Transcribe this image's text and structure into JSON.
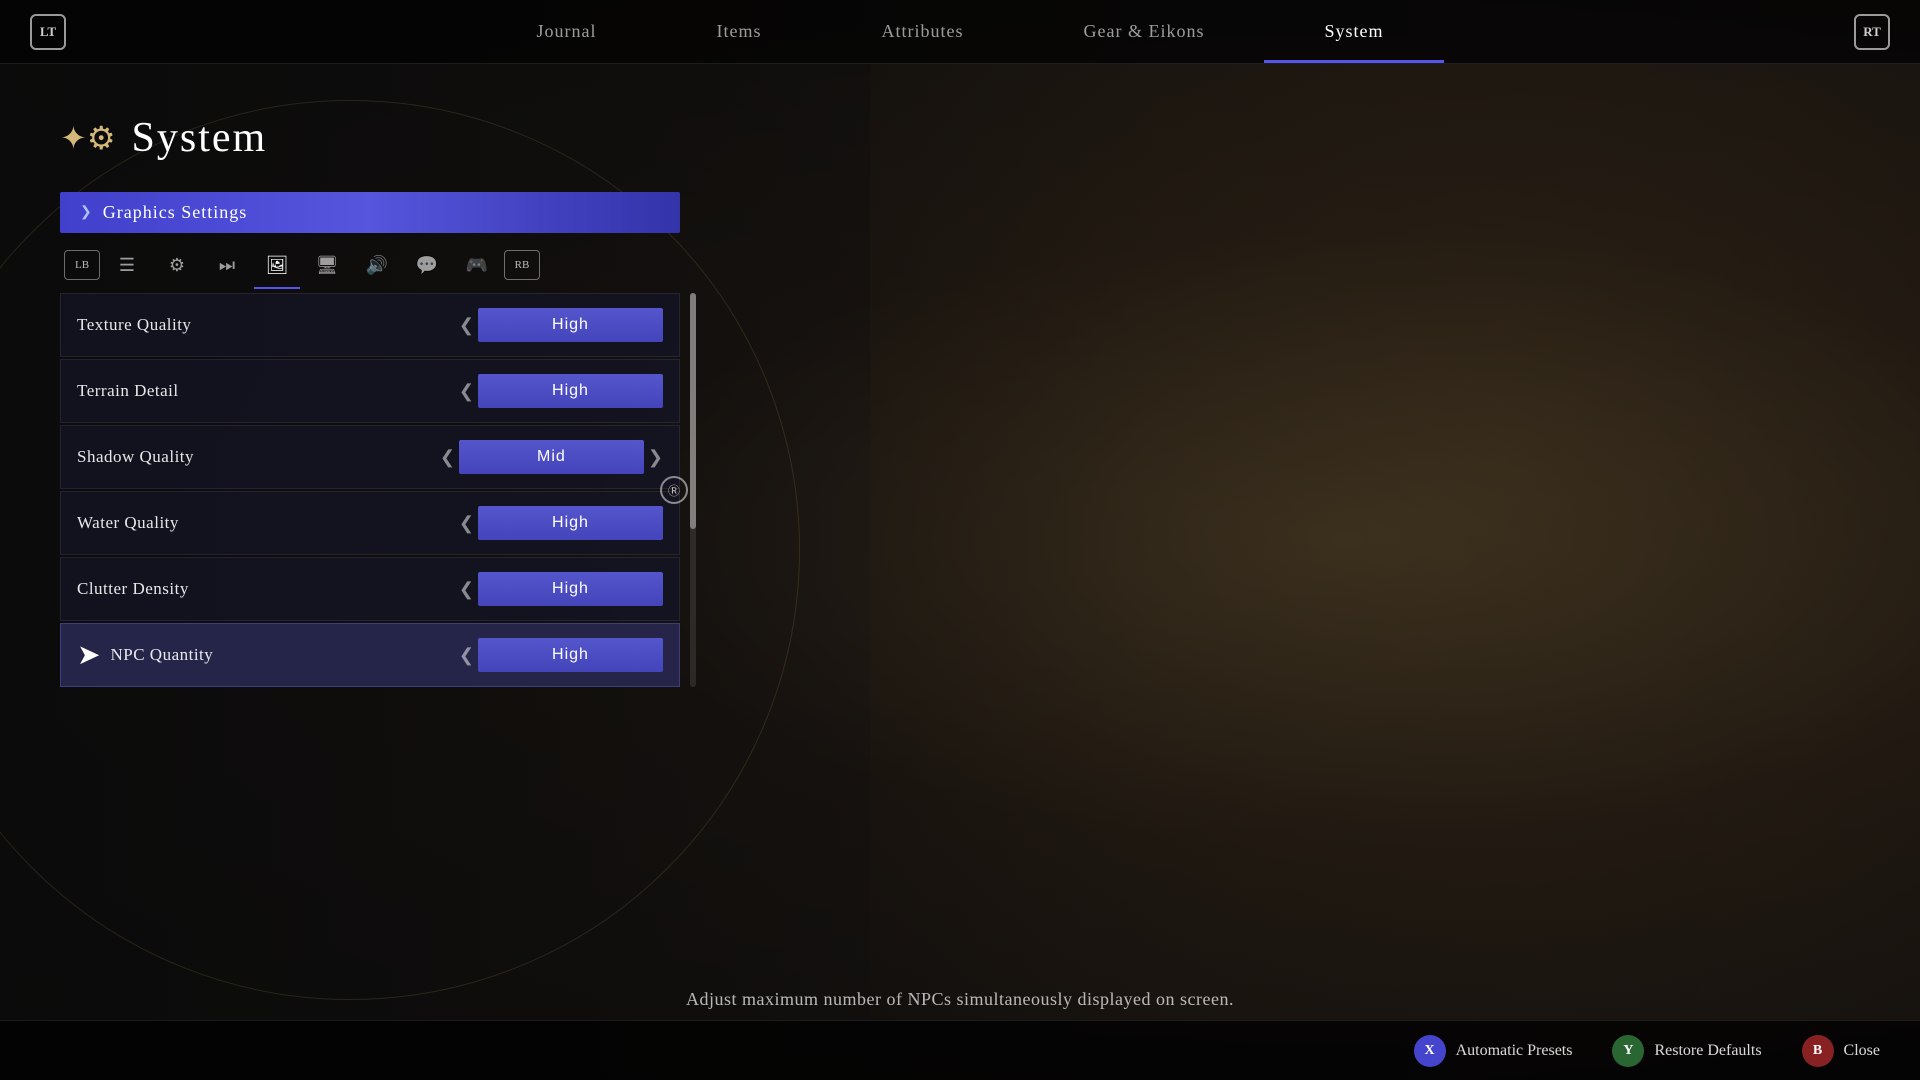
{
  "nav": {
    "left_btn": "LT",
    "right_btn": "RT",
    "tabs": [
      {
        "id": "journal",
        "label": "Journal",
        "active": false
      },
      {
        "id": "items",
        "label": "Items",
        "active": false
      },
      {
        "id": "attributes",
        "label": "Attributes",
        "active": false
      },
      {
        "id": "gear",
        "label": "Gear & Eikons",
        "active": false
      },
      {
        "id": "system",
        "label": "System",
        "active": true
      }
    ]
  },
  "page": {
    "title": "System",
    "icon": "⚙"
  },
  "section": {
    "label": "Graphics Settings"
  },
  "tab_icons": [
    {
      "id": "lb",
      "label": "LB",
      "type": "nav"
    },
    {
      "id": "list",
      "symbol": "☰",
      "active": false
    },
    {
      "id": "gear",
      "symbol": "⚙",
      "active": false
    },
    {
      "id": "media",
      "symbol": "⏭",
      "active": false
    },
    {
      "id": "image",
      "symbol": "🖼",
      "active": true
    },
    {
      "id": "display",
      "symbol": "🖥",
      "active": false
    },
    {
      "id": "audio",
      "symbol": "🔊",
      "active": false
    },
    {
      "id": "chat",
      "symbol": "💬",
      "active": false
    },
    {
      "id": "gamepad",
      "symbol": "🎮",
      "active": false
    },
    {
      "id": "rb",
      "label": "RB",
      "type": "nav"
    }
  ],
  "settings": [
    {
      "id": "texture-quality",
      "label": "Texture Quality",
      "value": "High",
      "selected": false,
      "has_right_arrow": false
    },
    {
      "id": "terrain-detail",
      "label": "Terrain Detail",
      "value": "High",
      "selected": false,
      "has_right_arrow": false
    },
    {
      "id": "shadow-quality",
      "label": "Shadow Quality",
      "value": "Mid",
      "selected": false,
      "has_right_arrow": true
    },
    {
      "id": "water-quality",
      "label": "Water Quality",
      "value": "High",
      "selected": false,
      "has_right_arrow": false
    },
    {
      "id": "clutter-density",
      "label": "Clutter Density",
      "value": "High",
      "selected": false,
      "has_right_arrow": false
    },
    {
      "id": "npc-quantity",
      "label": "NPC Quantity",
      "value": "High",
      "selected": true,
      "has_right_arrow": false
    }
  ],
  "description": "Adjust maximum number of NPCs simultaneously displayed on screen.",
  "bottom_actions": [
    {
      "id": "automatic-presets",
      "btn_label": "X",
      "btn_class": "btn-x",
      "label": "Automatic Presets"
    },
    {
      "id": "restore-defaults",
      "btn_label": "Y",
      "btn_class": "btn-y",
      "label": "Restore Defaults"
    },
    {
      "id": "close",
      "btn_label": "B",
      "btn_class": "btn-b",
      "label": "Close"
    }
  ],
  "r_indicator": "Ⓡ"
}
